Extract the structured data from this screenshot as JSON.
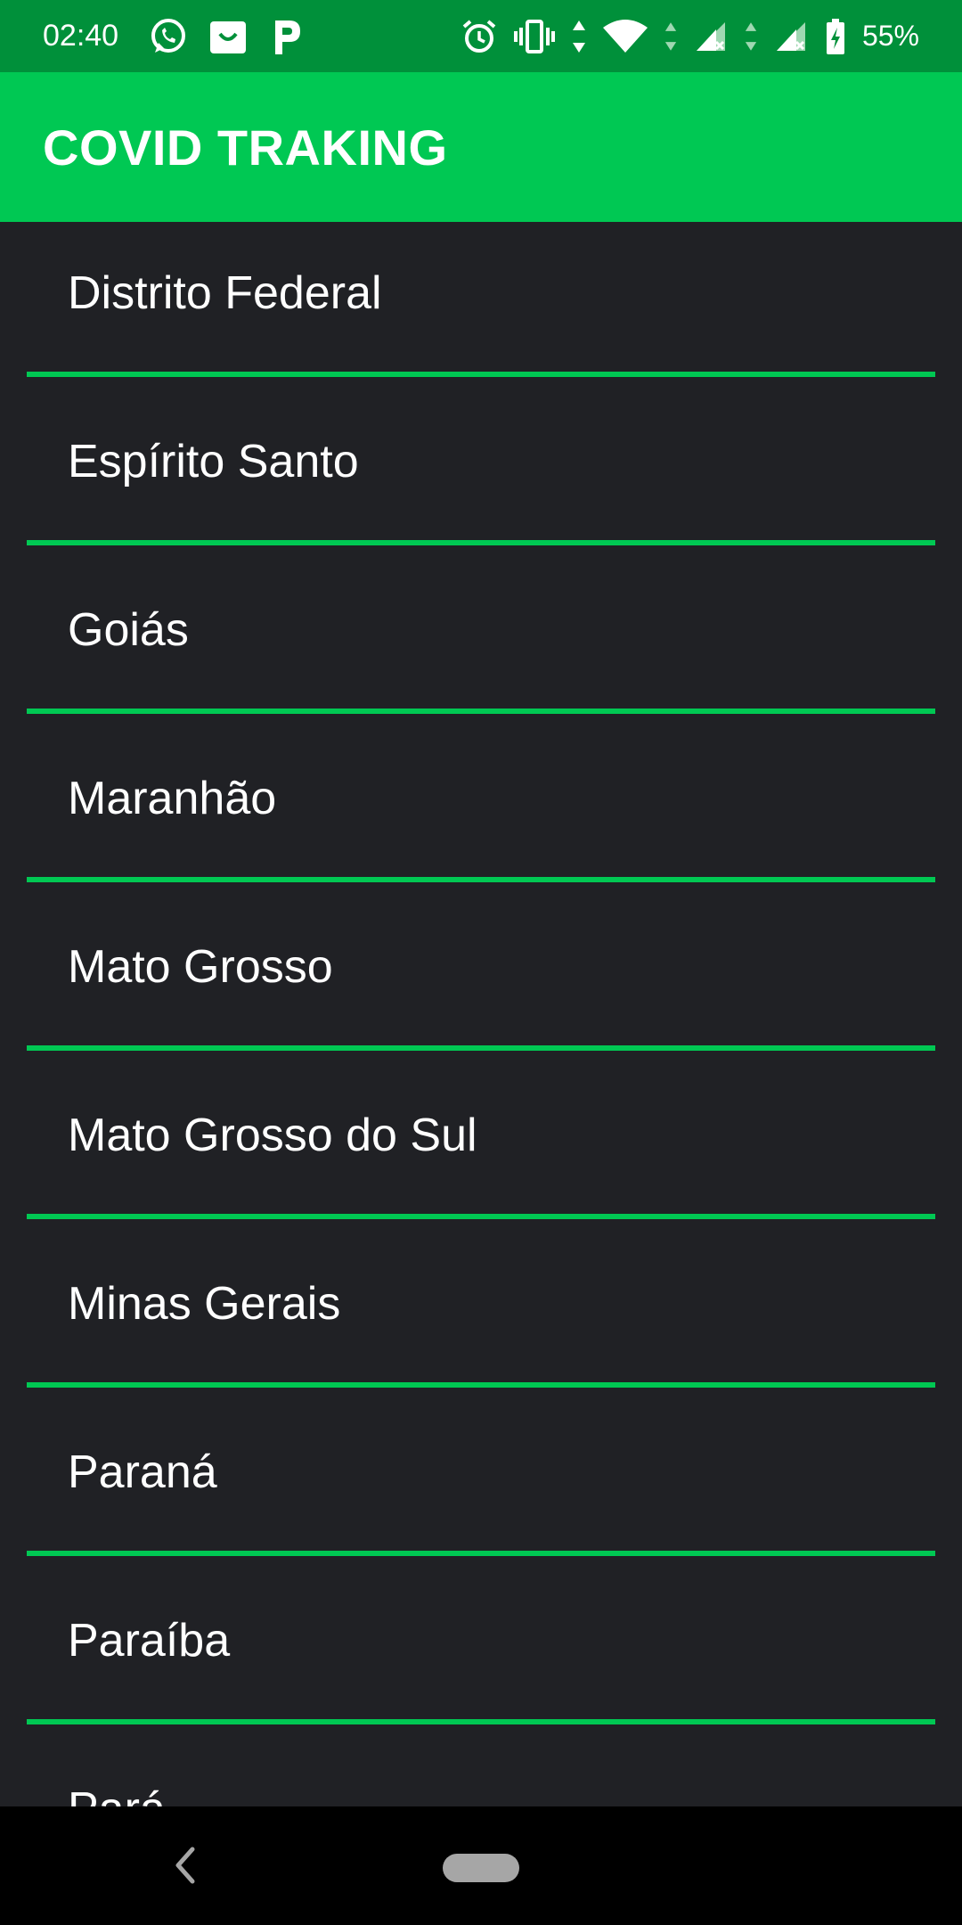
{
  "status_bar": {
    "time": "02:40",
    "battery_percent": "55%",
    "left_icons": [
      "whatsapp-icon",
      "shopping-bag-icon",
      "p-app-icon"
    ],
    "right_icons": [
      "alarm-icon",
      "vibrate-icon",
      "data-arrows-icon",
      "wifi-icon",
      "signal-no-sim-icon",
      "signal-no-sim-icon",
      "battery-icon"
    ],
    "background": "#00903a"
  },
  "app_bar": {
    "title": "COVID TRAKING",
    "background": "#00c853"
  },
  "states": [
    {
      "name": "Distrito Federal"
    },
    {
      "name": "Espírito Santo"
    },
    {
      "name": "Goiás"
    },
    {
      "name": "Maranhão"
    },
    {
      "name": "Mato Grosso"
    },
    {
      "name": "Mato Grosso do Sul"
    },
    {
      "name": "Minas Gerais"
    },
    {
      "name": "Paraná"
    },
    {
      "name": "Paraíba"
    },
    {
      "name": "Pará"
    }
  ],
  "colors": {
    "list_background": "#202125",
    "divider": "#00c853",
    "text": "#ffffff",
    "nav_background": "#000000"
  },
  "nav_bar": {
    "icons": [
      "back-icon",
      "home-pill-icon"
    ]
  }
}
